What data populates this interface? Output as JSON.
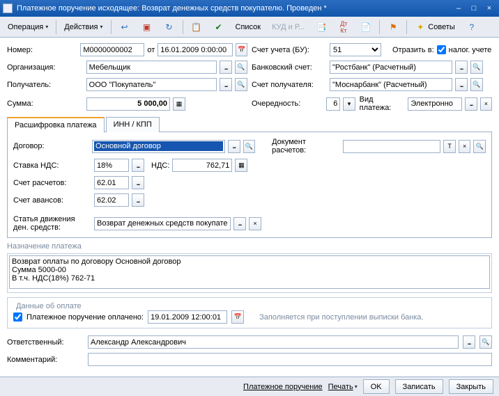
{
  "title": "Платежное поручение исходящее: Возврат денежных средств покупателю. Проведен *",
  "toolbar": {
    "operation": "Операция",
    "actions": "Действия",
    "list": "Список",
    "kudir": "КУД и Р...",
    "advice": "Советы"
  },
  "fields": {
    "number_label": "Номер:",
    "number": "М0000000002",
    "ot": "от",
    "date": "16.01.2009 0:00:00",
    "org_label": "Организация:",
    "org": "Мебельщик",
    "recip_label": "Получатель:",
    "recip": "ООО \"Покупатель\"",
    "sum_label": "Сумма:",
    "sum": "5 000,00",
    "account_bu_label": "Счет учета (БУ):",
    "account_bu": "51",
    "reflect": "Отразить в:",
    "nalog": "налог. учете",
    "bank_label": "Банковский счет:",
    "bank": "\"Ростбанк\" (Расчетный)",
    "recip_acc_label": "Счет получателя:",
    "recip_acc": "\"Моснарбанк\" (Расчетный)",
    "seq_label": "Очередность:",
    "seq": "6",
    "paytype_label": "Вид платежа:",
    "paytype": "Электронно"
  },
  "tabs": {
    "tab1": "Расшифровка платежа",
    "tab2": "ИНН / КПП"
  },
  "detail": {
    "contract_label": "Договор:",
    "contract": "Основной договор",
    "vat_rate_label": "Ставка НДС:",
    "vat_rate": "18%",
    "vat_label": "НДС:",
    "vat": "762,71",
    "calc_acc_label": "Счет расчетов:",
    "calc_acc": "62.01",
    "adv_acc_label": "Счет авансов:",
    "adv_acc": "62.02",
    "flow_label1": "Статья движения",
    "flow_label2": "ден. средств:",
    "flow": "Возврат денежных средств покупате",
    "doc_label": "Документ расчетов:",
    "doc": ""
  },
  "purpose": {
    "title": "Назначение платежа",
    "text": "Возврат оплаты по договору Основной договор\nСумма 5000-00\nВ т.ч. НДС(18%) 762-71"
  },
  "payment": {
    "title": "Данные об оплате",
    "paid_label": "Платежное поручение оплачено:",
    "paid_date": "19.01.2009 12:00:01",
    "hint": "Заполняется при поступлении выписки банка."
  },
  "footer": {
    "resp_label": "Ответственный:",
    "resp": "Александр Александрович",
    "comment_label": "Комментарий:",
    "comment": ""
  },
  "bottom": {
    "po": "Платежное поручение",
    "print": "Печать",
    "ok": "OK",
    "save": "Записать",
    "close": "Закрыть"
  }
}
